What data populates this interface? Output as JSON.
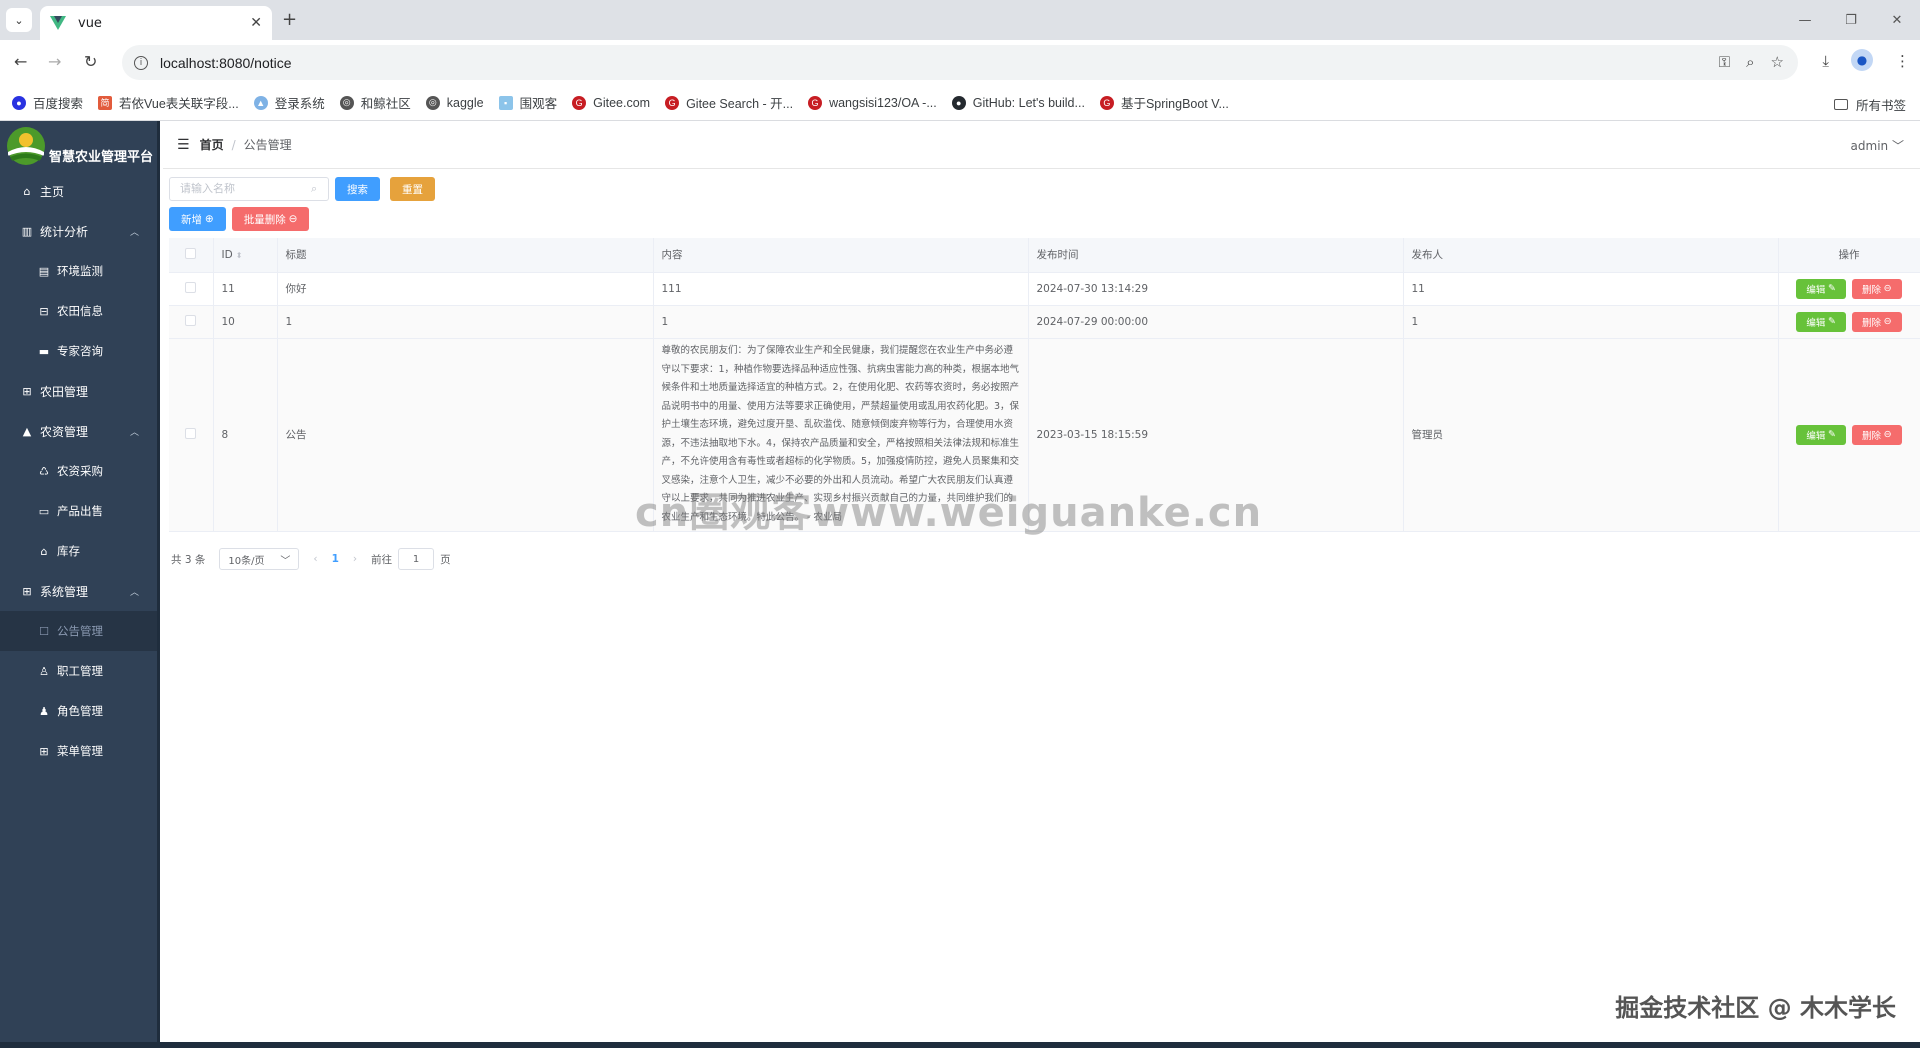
{
  "browser": {
    "tab_title": "vue",
    "url": "localhost:8080/notice",
    "bookmarks": [
      "百度搜索",
      "若依Vue表关联字段...",
      "登录系统",
      "和鲸社区",
      "kaggle",
      "围观客",
      "Gitee.com",
      "Gitee Search - 开...",
      "wangsisi123/OA -...",
      "GitHub: Let's build...",
      "基于SpringBoot V..."
    ],
    "all_bookmarks": "所有书签"
  },
  "sidebar": {
    "title": "智慧农业管理平台",
    "items": [
      {
        "label": "主页",
        "icon": "home-icon"
      },
      {
        "label": "统计分析",
        "icon": "bar-chart-icon"
      },
      {
        "label": "环境监测",
        "icon": "monitor-icon"
      },
      {
        "label": "农田信息",
        "icon": "field-icon"
      },
      {
        "label": "专家咨询",
        "icon": "chat-icon"
      },
      {
        "label": "农田管理",
        "icon": "grid-icon"
      },
      {
        "label": "农资管理",
        "icon": "lock-icon"
      },
      {
        "label": "农资采购",
        "icon": "cart-icon"
      },
      {
        "label": "产品出售",
        "icon": "sale-icon"
      },
      {
        "label": "库存",
        "icon": "house-icon"
      },
      {
        "label": "系统管理",
        "icon": "grid-icon"
      },
      {
        "label": "公告管理",
        "icon": "notice-icon"
      },
      {
        "label": "职工管理",
        "icon": "user-icon"
      },
      {
        "label": "角色管理",
        "icon": "role-icon"
      },
      {
        "label": "菜单管理",
        "icon": "menu-icon"
      }
    ]
  },
  "navbar": {
    "home": "首页",
    "sep": "/",
    "current": "公告管理",
    "user": "admin"
  },
  "search": {
    "placeholder": "请输入名称",
    "search_label": "搜索",
    "reset_label": "重置",
    "add_label": "新增",
    "batch_delete_label": "批量删除"
  },
  "table": {
    "headers": [
      "ID",
      "标题",
      "内容",
      "发布时间",
      "发布人",
      "操作"
    ],
    "rows": [
      {
        "id": "11",
        "title": "你好",
        "content": "111",
        "time": "2024-07-30 13:14:29",
        "user": "11"
      },
      {
        "id": "10",
        "title": "1",
        "content": "1",
        "time": "2024-07-29 00:00:00",
        "user": "1"
      },
      {
        "id": "8",
        "title": "公告",
        "content": "尊敬的农民朋友们：为了保障农业生产和全民健康，我们提醒您在农业生产中务必遵守以下要求：1，种植作物要选择品种适应性强、抗病虫害能力高的种类，根据本地气候条件和土地质量选择适宜的种植方式。2，在使用化肥、农药等农资时，务必按照产品说明书中的用量、使用方法等要求正确使用，严禁超量使用或乱用农药化肥。3，保护土壤生态环境，避免过度开垦、乱砍滥伐、随意倾倒废弃物等行为，合理使用水资源，不违法抽取地下水。4，保持农产品质量和安全，严格按照相关法律法规和标准生产，不允许使用含有毒性或者超标的化学物质。5，加强疫情防控，避免人员聚集和交叉感染，注意个人卫生，减少不必要的外出和人员流动。希望广大农民朋友们认真遵守以上要求，共同为推进农业生产、实现乡村振兴贡献自己的力量，共同维护我们的农业生产和生态环境。特此公告。 - 农业局",
        "time": "2023-03-15 18:15:59",
        "user": "管理员"
      }
    ],
    "edit_label": "编辑",
    "delete_label": "删除"
  },
  "pagination": {
    "total": "共 3 条",
    "page_size": "10条/页",
    "current_page": "1",
    "goto_prefix": "前往",
    "goto_value": "1",
    "goto_suffix": "页"
  },
  "watermarks": {
    "center": "cn圈观客www.weiguanke.cn",
    "corner": "掘金技术社区 @ 木木学长"
  }
}
